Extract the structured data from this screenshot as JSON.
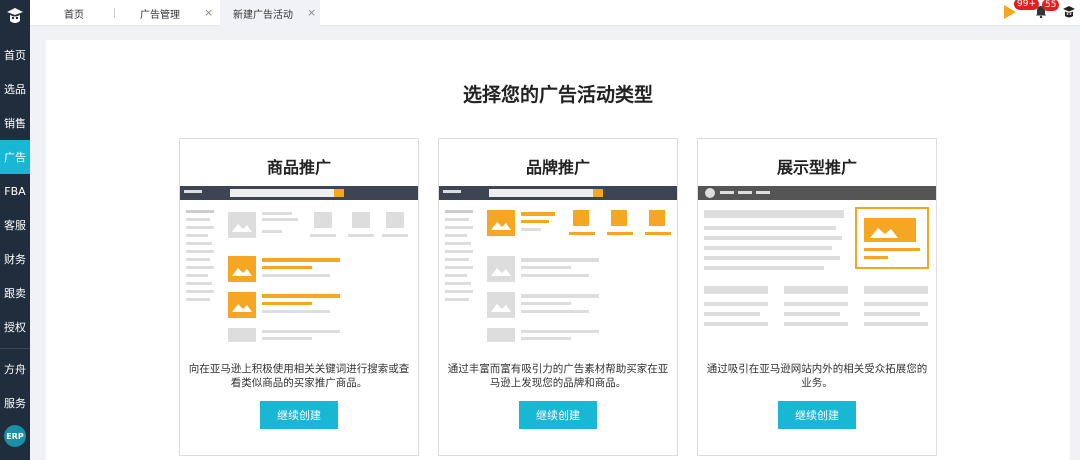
{
  "sidebar": {
    "items": [
      {
        "label": "首页",
        "active": false
      },
      {
        "label": "选品",
        "active": false
      },
      {
        "label": "销售",
        "active": false
      },
      {
        "label": "广告",
        "active": true
      },
      {
        "label": "FBA",
        "active": false
      },
      {
        "label": "客服",
        "active": false
      },
      {
        "label": "财务",
        "active": false
      },
      {
        "label": "跟卖",
        "active": false
      },
      {
        "label": "授权",
        "active": false
      },
      {
        "label": "方舟",
        "active": false
      },
      {
        "label": "服务",
        "active": false
      }
    ],
    "erp_label": "ERP"
  },
  "tabs": [
    {
      "label": "首页",
      "active": false,
      "closable": false
    },
    {
      "label": "广告管理",
      "active": false,
      "closable": true
    },
    {
      "label": "新建广告活动",
      "active": true,
      "closable": true
    }
  ],
  "tab_close_glyph": "×",
  "header": {
    "flag_badge": "99+",
    "bell_badge": "55"
  },
  "main": {
    "title": "选择您的广告活动类型",
    "cards": [
      {
        "title": "商品推广",
        "description": "向在亚马逊上积极使用相关关键词进行搜索或查看类似商品的买家推广商品。",
        "button": "继续创建"
      },
      {
        "title": "品牌推广",
        "description": "通过丰富而富有吸引力的广告素材帮助买家在亚马逊上发现您的品牌和商品。",
        "button": "继续创建"
      },
      {
        "title": "展示型推广",
        "description": "通过吸引在亚马逊网站内外的相关受众拓展您的业务。",
        "button": "继续创建"
      }
    ]
  },
  "colors": {
    "accent": "#1ab7d4",
    "sidebar_bg": "#1f2d3d",
    "illustration_orange": "#f5a623",
    "badge_red": "#e02020"
  }
}
